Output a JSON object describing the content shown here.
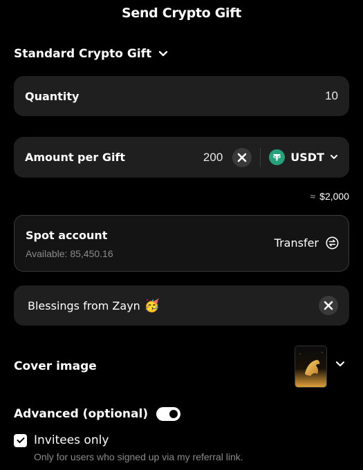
{
  "header": {
    "title": "Send Crypto Gift"
  },
  "gift_type": {
    "label": "Standard Crypto Gift",
    "icon": "chevron-down-icon"
  },
  "quantity": {
    "label": "Quantity",
    "value": "10"
  },
  "amount": {
    "label": "Amount per Gift",
    "value": "200",
    "clear_icon": "close-icon",
    "token": "USDT",
    "token_icon": "tether-icon",
    "approx_symbol": "≈",
    "approx_value": "$2,000"
  },
  "spot_account": {
    "title": "Spot account",
    "available": "Available: 85,450.16",
    "transfer_label": "Transfer",
    "transfer_icon": "transfer-icon"
  },
  "message": {
    "text": "Blessings from Zayn",
    "emoji": "🥳",
    "clear_icon": "close-icon"
  },
  "cover": {
    "label": "Cover image",
    "icon": "chevron-down-icon"
  },
  "advanced": {
    "label": "Advanced (optional)",
    "enabled": true
  },
  "invitees": {
    "label": "Invitees only",
    "checked": true,
    "hint": "Only for users who signed up via my referral link."
  },
  "colors": {
    "background": "#000000",
    "card": "#1f1f1f",
    "tether_green": "#26a17b",
    "muted_text": "#8a8a8a"
  }
}
